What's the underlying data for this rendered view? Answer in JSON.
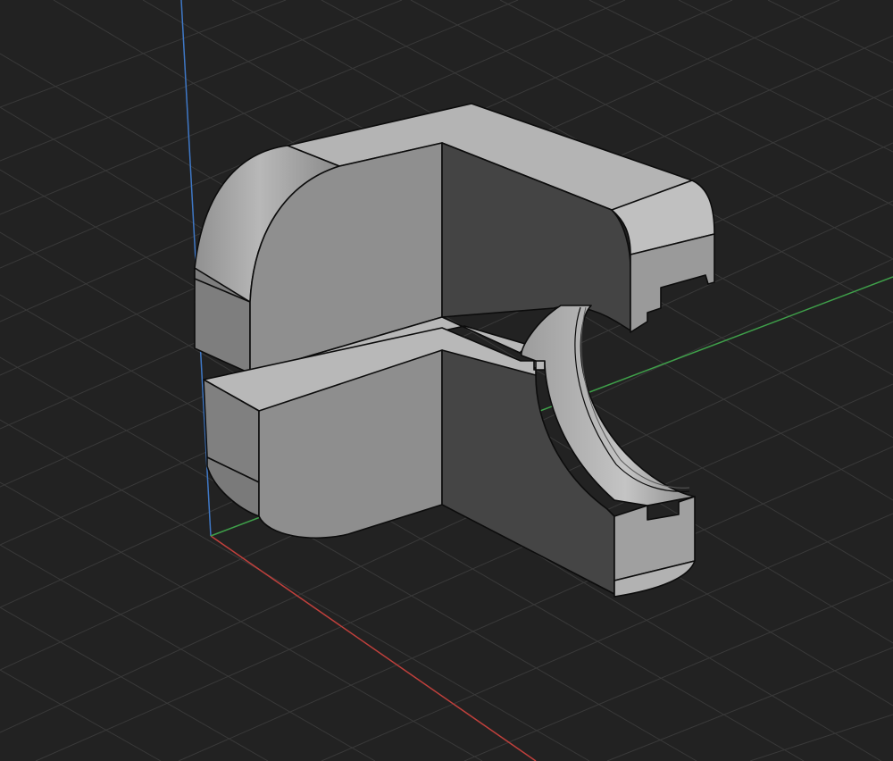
{
  "viewport": {
    "background_color": "#222222",
    "grid_color": "#3a3a3a",
    "axes": {
      "x_color": "#c0403c",
      "y_color": "#3fa04a",
      "z_color": "#3f78c6"
    }
  },
  "model": {
    "description_icon": "cad-part-icon",
    "face_colors": {
      "top": "#b6b6b6",
      "side": "#8e8e8e",
      "front": "#6f6f6f",
      "dark": "#464646",
      "edge": "#0c0c0c"
    }
  }
}
